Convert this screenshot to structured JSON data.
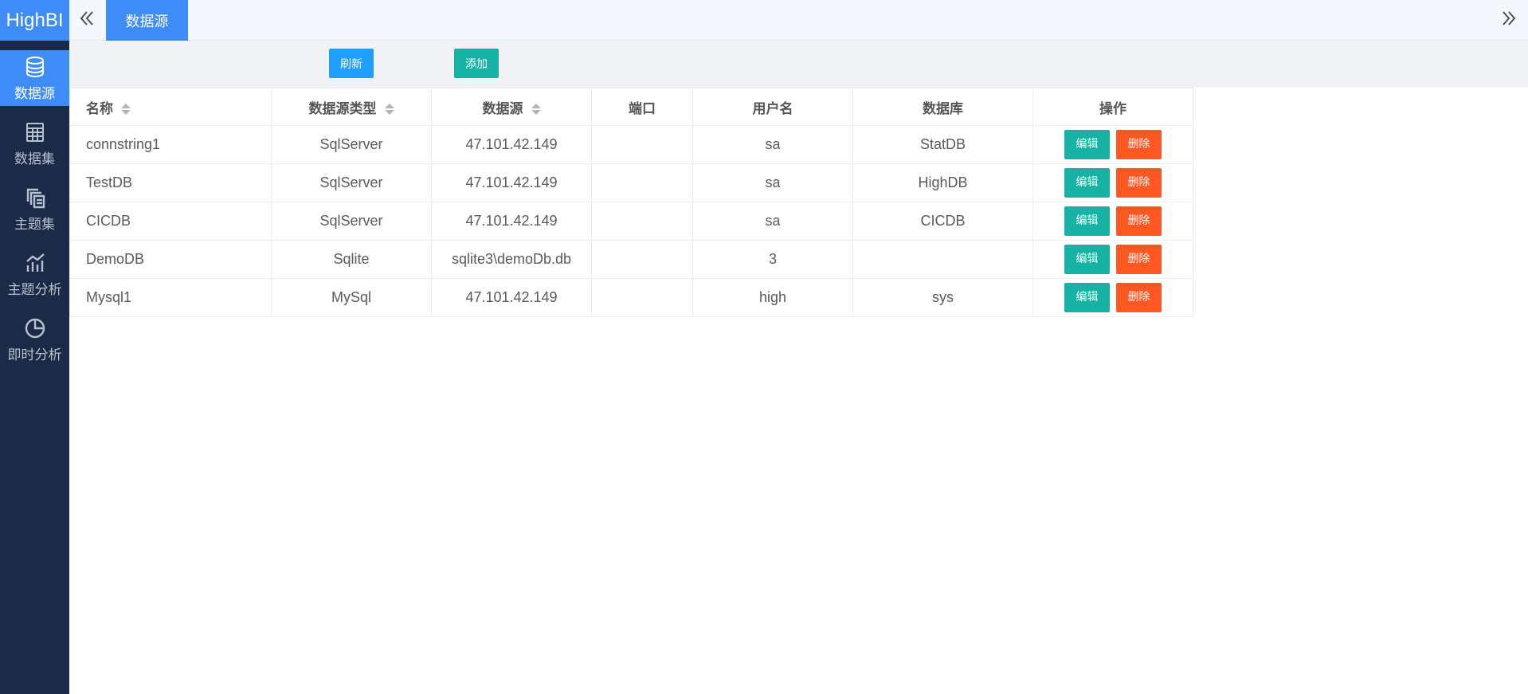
{
  "app": {
    "logo": "HighBI"
  },
  "sidebar": {
    "items": [
      {
        "label": "数据源",
        "icon": "database-icon",
        "active": true
      },
      {
        "label": "数据集",
        "icon": "table-grid-icon",
        "active": false
      },
      {
        "label": "主题集",
        "icon": "copy-stack-icon",
        "active": false
      },
      {
        "label": "主题分析",
        "icon": "bar-trend-icon",
        "active": false
      },
      {
        "label": "即时分析",
        "icon": "pie-chart-icon",
        "active": false
      }
    ]
  },
  "tabs": {
    "active_label": "数据源"
  },
  "toolbar": {
    "refresh_label": "刷新",
    "add_label": "添加"
  },
  "table": {
    "columns": [
      "名称",
      "数据源类型",
      "数据源",
      "端口",
      "用户名",
      "数据库",
      "操作"
    ],
    "rows": [
      {
        "name": "connstring1",
        "type": "SqlServer",
        "source": "47.101.42.149",
        "port": "",
        "user": "sa",
        "database": "StatDB"
      },
      {
        "name": "TestDB",
        "type": "SqlServer",
        "source": "47.101.42.149",
        "port": "",
        "user": "sa",
        "database": "HighDB"
      },
      {
        "name": "CICDB",
        "type": "SqlServer",
        "source": "47.101.42.149",
        "port": "",
        "user": "sa",
        "database": "CICDB"
      },
      {
        "name": "DemoDB",
        "type": "Sqlite",
        "source": "sqlite3\\demoDb.db",
        "port": "",
        "user": "3",
        "database": ""
      },
      {
        "name": "Mysql1",
        "type": "MySql",
        "source": "47.101.42.149",
        "port": "",
        "user": "high",
        "database": "sys"
      }
    ],
    "edit_label": "编辑",
    "delete_label": "删除"
  },
  "colors": {
    "primary": "#3e8cf7",
    "sidebar": "#1b2a47",
    "refresh": "#1e9fff",
    "edit": "#16b2a4",
    "delete": "#ff5722"
  }
}
